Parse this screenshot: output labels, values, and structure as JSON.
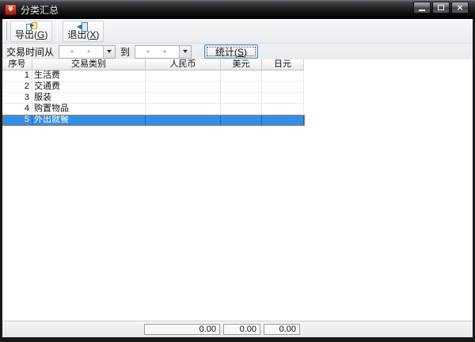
{
  "window": {
    "title": "分类汇总",
    "app_icon_glyph": "¥",
    "close_glyph": "×"
  },
  "toolbar": {
    "export": {
      "prefix": "导出(",
      "mnemonic": "G",
      "suffix": ")"
    },
    "exit": {
      "prefix": "退出(",
      "mnemonic": "X",
      "suffix": ")"
    }
  },
  "filter": {
    "from_label": "交易时间从",
    "to_label": "到",
    "date_from": "-   -",
    "date_to": "-   -",
    "stats": {
      "prefix": "统计(",
      "mnemonic": "S",
      "suffix": ")"
    }
  },
  "table": {
    "columns": [
      "序号",
      "交易类别",
      "人民币",
      "美元",
      "日元"
    ],
    "rows": [
      {
        "no": "1",
        "category": "生活费",
        "rmb": "",
        "usd": "",
        "jpy": ""
      },
      {
        "no": "2",
        "category": "交通费",
        "rmb": "",
        "usd": "",
        "jpy": ""
      },
      {
        "no": "3",
        "category": "服装",
        "rmb": "",
        "usd": "",
        "jpy": ""
      },
      {
        "no": "4",
        "category": "购置物品",
        "rmb": "",
        "usd": "",
        "jpy": ""
      },
      {
        "no": "5",
        "category": "外出就餐",
        "rmb": "",
        "usd": "",
        "jpy": ""
      }
    ],
    "selected_row": 5
  },
  "totals": {
    "rmb": "0.00",
    "usd": "0.00",
    "jpy": "0.00"
  },
  "colors": {
    "selection_bg": "#2e90ee",
    "selection_border": "#ad7845",
    "titlebar_bg": "#141518",
    "app_icon_bg": "#b01708",
    "toolbar_bg": "#eef0f3"
  }
}
